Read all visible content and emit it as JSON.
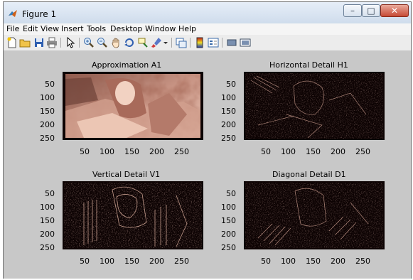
{
  "window": {
    "title": "Figure 1",
    "controls": {
      "minimize": "–",
      "maximize": "□",
      "close": "✕"
    }
  },
  "menu": [
    "File",
    "Edit",
    "View",
    "Insert",
    "Tools",
    "Desktop",
    "Window",
    "Help"
  ],
  "toolbar_icons": [
    "new-figure-icon",
    "open-file-icon",
    "save-icon",
    "print-icon",
    "arrow-select-icon",
    "zoom-in-icon",
    "zoom-out-icon",
    "pan-hand-icon",
    "rotate-3d-icon",
    "data-cursor-icon",
    "brush-icon",
    "brush-dropdown-icon",
    "link-plot-icon",
    "colorbar-icon",
    "legend-icon",
    "hide-plot-tools-icon",
    "show-plot-tools-icon"
  ],
  "subplots": [
    {
      "title": "Approximation A1",
      "kind": "approximation",
      "yticks": [
        "50",
        "100",
        "150",
        "200",
        "250"
      ],
      "xticks": [
        "50",
        "100",
        "150",
        "200",
        "250"
      ]
    },
    {
      "title": "Horizontal Detail H1",
      "kind": "detail",
      "yticks": [
        "50",
        "100",
        "150",
        "200",
        "250"
      ],
      "xticks": [
        "50",
        "100",
        "150",
        "200",
        "250"
      ]
    },
    {
      "title": "Vertical Detail V1",
      "kind": "detail",
      "yticks": [
        "50",
        "100",
        "150",
        "200",
        "250"
      ],
      "xticks": [
        "50",
        "100",
        "150",
        "200",
        "250"
      ]
    },
    {
      "title": "Diagonal Detail D1",
      "kind": "detail",
      "yticks": [
        "50",
        "100",
        "150",
        "200",
        "250"
      ],
      "xticks": [
        "50",
        "100",
        "150",
        "200",
        "250"
      ]
    }
  ],
  "colors": {
    "plot_background": "#c8c8c8",
    "image_dark": "#0d0303",
    "image_light": "#f2d2c2",
    "detail_texture": "#b07a6a"
  }
}
